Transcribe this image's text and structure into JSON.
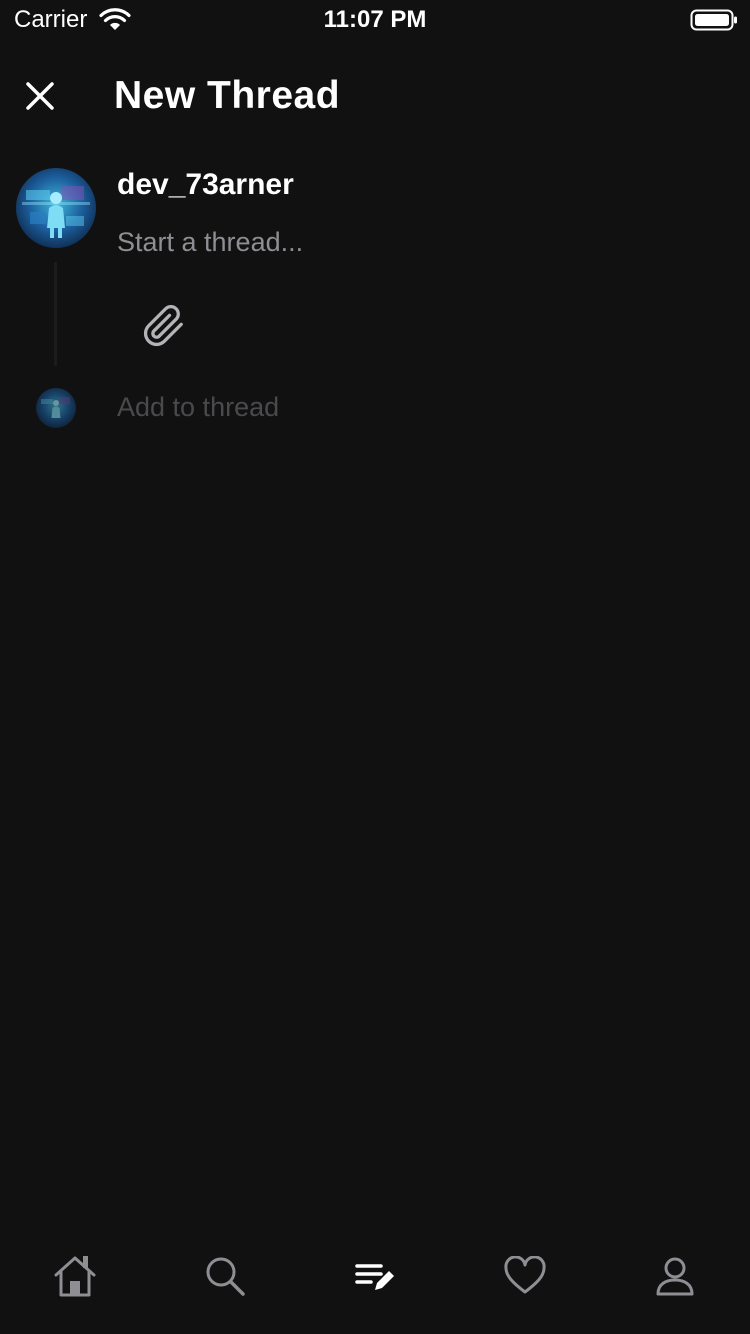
{
  "status_bar": {
    "carrier": "Carrier",
    "time": "11:07 PM",
    "icons": [
      "wifi-icon",
      "battery-icon"
    ]
  },
  "header": {
    "title": "New Thread",
    "close_icon": "close-icon"
  },
  "composer": {
    "username": "dev_73arner",
    "placeholder": "Start a thread...",
    "value": "",
    "attach_icon": "paperclip-icon",
    "add_to_thread_label": "Add to thread"
  },
  "tab_bar": {
    "tabs": [
      {
        "icon": "home-icon"
      },
      {
        "icon": "search-icon"
      },
      {
        "icon": "compose-icon",
        "active": true
      },
      {
        "icon": "heart-icon"
      },
      {
        "icon": "profile-icon"
      }
    ]
  },
  "colors": {
    "background": "#111112",
    "text_primary": "#ffffff",
    "text_placeholder": "#8e8e93",
    "text_disabled": "#4a4a4d",
    "tab_inactive": "#8e8e93",
    "tab_active": "#ffffff"
  }
}
